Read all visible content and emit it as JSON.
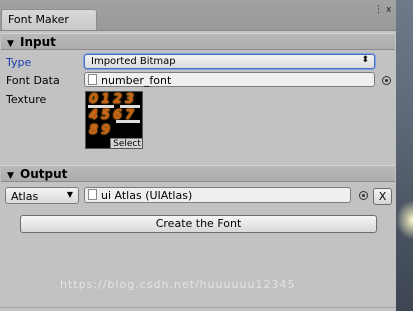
{
  "window": {
    "tab_title": "Font Maker",
    "controls": {
      "menu_icon": "⋮",
      "close_icon": "x"
    }
  },
  "input_section": {
    "header": "Input",
    "type": {
      "label": "Type",
      "value": "Imported Bitmap"
    },
    "font_data": {
      "label": "Font Data",
      "value": "number_font"
    },
    "texture": {
      "label": "Texture",
      "select_label": "Select",
      "glyph_rows": [
        [
          "0",
          "1",
          "2",
          "3"
        ],
        [
          "4",
          "5",
          "6",
          "7"
        ],
        [
          "8",
          "9"
        ]
      ]
    }
  },
  "output_section": {
    "header": "Output",
    "atlas_dropdown": {
      "selected": "Atlas"
    },
    "atlas_field": {
      "value": "ui Atlas (UIAtlas)"
    },
    "clear_label": "X",
    "create_button_label": "Create the Font"
  },
  "watermark": "https://blog.csdn.net/huuuuuu12345",
  "colors": {
    "active_label": "#1a3fb0",
    "focus_border": "#4a6fbf",
    "panel_bg": "#c2c2c2"
  }
}
